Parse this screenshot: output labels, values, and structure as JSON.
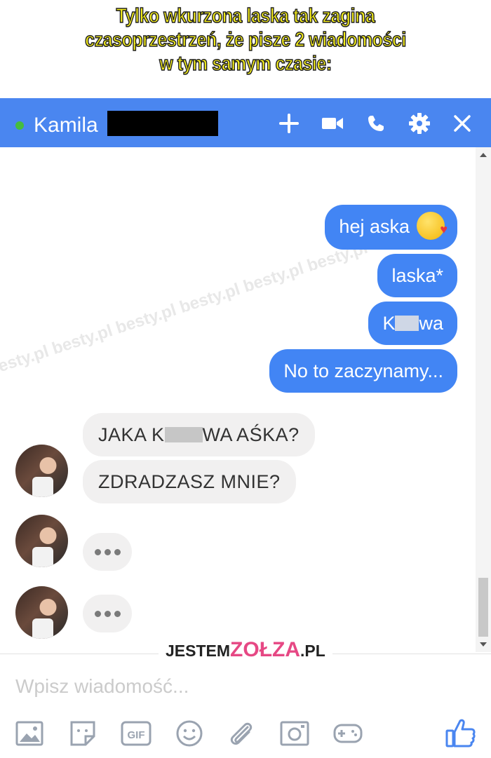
{
  "caption": {
    "line1": "Tylko wkurzona laska tak zagina",
    "line2": "czasoprzestrzeń, że pisze 2 wiadomości",
    "line3": "w tym samym czasie:"
  },
  "header": {
    "contact_name": "Kamila",
    "status": "online",
    "icons": [
      "plus-icon",
      "video-camera-icon",
      "phone-icon",
      "gear-icon",
      "close-icon"
    ]
  },
  "watermark": "besty.pl besty.pl besty.pl besty.pl besty.pl besty.pl",
  "outgoing": [
    {
      "text": "hej aska",
      "emoji": "kiss-face-emoji"
    },
    {
      "text": "laska*"
    },
    {
      "text_start": "K",
      "text_end": "wa"
    },
    {
      "text": "No to zaczynamy..."
    }
  ],
  "incoming": [
    {
      "text_start": "JAKA K",
      "text_end": "WA AŚKA?"
    },
    {
      "text": "ZDRADZASZ MNIE?"
    }
  ],
  "typing_indicator": "•••",
  "brand": {
    "part1": "JESTEM",
    "part2": "ZOŁZA",
    "part3": ".PL"
  },
  "composer": {
    "placeholder": "Wpisz wiadomość...",
    "tools": [
      "photo-icon",
      "sticker-icon",
      "gif-icon",
      "emoji-icon",
      "attachment-icon",
      "camera-icon",
      "game-controller-icon",
      "like-thumb-icon"
    ],
    "gif_label": "GIF"
  },
  "colors": {
    "header": "#4a86f0",
    "outgoing_bubble": "#4285f4",
    "incoming_bubble": "#f1f0f0",
    "online": "#45bd3e",
    "caption_text": "#f5ee1b"
  }
}
